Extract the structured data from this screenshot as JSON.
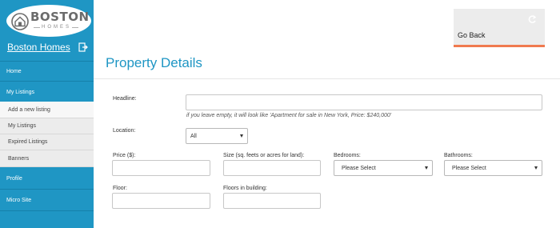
{
  "brand": {
    "logo_text": "BOSTON",
    "logo_sub": "HOMES",
    "site_title": "Boston Homes"
  },
  "sidebar": {
    "items": [
      {
        "label": "Home"
      },
      {
        "label": "My Listings"
      },
      {
        "label": "Add a new listing"
      },
      {
        "label": "My Listings"
      },
      {
        "label": "Expired Listings"
      },
      {
        "label": "Banners"
      },
      {
        "label": "Profile"
      },
      {
        "label": "Micro Site"
      }
    ],
    "active_sub": "Add a new listing"
  },
  "header": {
    "go_back_label": "Go Back"
  },
  "main": {
    "title": "Property Details",
    "fields": {
      "headline_label": "Headline:",
      "headline_value": "",
      "headline_hint": "if you leave empty, it will look like 'Apartment for sale in New York, Price: $240,000'",
      "location_label": "Location:",
      "location_value": "All",
      "price_label": "Price ($):",
      "size_label": "Size (sq. feets or acres for land):",
      "bedrooms_label": "Bedrooms:",
      "bedrooms_value": "Please Select",
      "bathrooms_label": "Bathrooms:",
      "bathrooms_value": "Please Select",
      "floor_label": "Floor:",
      "floors_in_building_label": "Floors in building:"
    }
  },
  "colors": {
    "sidebar": "#1f96c4",
    "accent": "#f07a4f",
    "title": "#1f96c4"
  }
}
